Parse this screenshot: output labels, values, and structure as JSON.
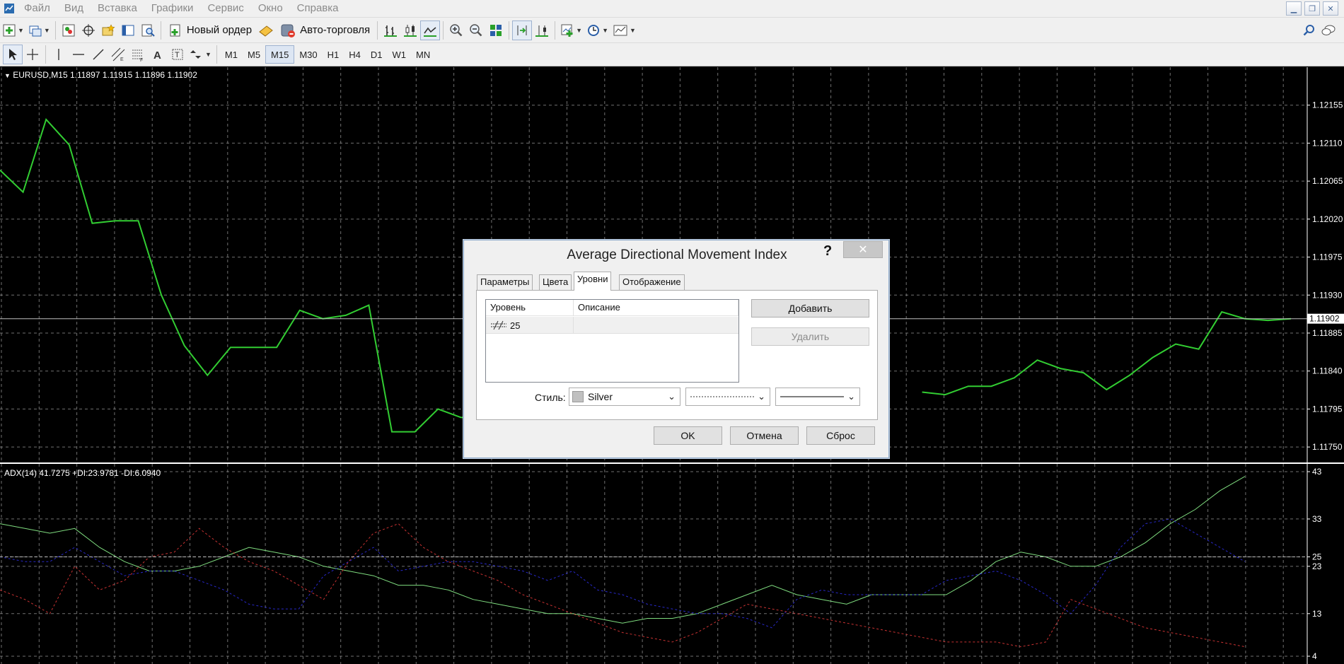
{
  "menu": [
    "Файл",
    "Вид",
    "Вставка",
    "Графики",
    "Сервис",
    "Окно",
    "Справка"
  ],
  "toolbar1": {
    "new_order_label": "Новый ордер",
    "autotrading_label": "Авто-торговля"
  },
  "timeframes": [
    "M1",
    "M5",
    "M15",
    "M30",
    "H1",
    "H4",
    "D1",
    "W1",
    "MN"
  ],
  "active_timeframe": "M15",
  "main_chart": {
    "caption": "EURUSD,M15  1.11897 1.11915 1.11896 1.11902",
    "price_labels": [
      "1.12155",
      "1.12110",
      "1.12065",
      "1.12020",
      "1.11975",
      "1.11930",
      "1.11885",
      "1.11840",
      "1.11795",
      "1.11750"
    ],
    "current_price": "1.11902",
    "line_color": "#32cd32"
  },
  "sub_chart": {
    "caption": "ADX(14) 41.7275 +DI:23.9781 -DI:6.0940",
    "scale_labels": [
      "43",
      "33",
      "25",
      "23",
      "13",
      "4"
    ]
  },
  "dialog": {
    "title": "Average Directional Movement Index",
    "help": "?",
    "close": "✕",
    "tabs": [
      "Параметры",
      "Цвета",
      "Уровни",
      "Отображение"
    ],
    "active_tab": "Уровни",
    "table": {
      "col_level": "Уровень",
      "col_description": "Описание",
      "rows": [
        {
          "level": "25",
          "description": ""
        }
      ]
    },
    "add_button": "Добавить",
    "delete_button": "Удалить",
    "style_label": "Стиль:",
    "color_value": "Silver",
    "color_swatch": "#c0c0c0",
    "ok_button": "OK",
    "cancel_button": "Отмена",
    "reset_button": "Сброс"
  },
  "chart_data": [
    {
      "type": "line",
      "title": "",
      "symbol": "EURUSD",
      "timeframe": "M15",
      "ylim": [
        1.1173,
        1.122
      ],
      "series": [
        {
          "color": "#32cd32",
          "values": [
            1.12078,
            1.12052,
            1.12138,
            1.12108,
            1.12015,
            1.12018,
            1.12018,
            1.1193,
            1.1187,
            1.11835,
            1.11868,
            1.11868,
            1.11868,
            1.11912,
            1.11902,
            1.11906,
            1.11918,
            1.11768,
            1.11768,
            1.11795,
            1.11785,
            1.11785,
            null,
            null,
            null,
            null,
            null,
            null,
            null,
            null,
            null,
            null,
            null,
            null,
            null,
            null,
            null,
            null,
            null,
            null,
            1.11815,
            1.11812,
            1.11822,
            1.11822,
            1.11832,
            1.11853,
            1.11843,
            1.11838,
            1.11818,
            1.11835,
            1.11856,
            1.11872,
            1.11866,
            1.1191,
            1.11902,
            1.119,
            1.11902
          ]
        }
      ],
      "grid": true
    },
    {
      "type": "line",
      "title": "",
      "indicator": "ADX(14)",
      "ylim": [
        4,
        43
      ],
      "levels": [
        25
      ],
      "series": [
        {
          "name": "ADX",
          "color": "#7fdc7f",
          "style": "solid",
          "values": [
            32,
            31,
            30,
            31,
            27,
            24,
            22,
            22,
            23,
            25,
            27,
            26,
            25,
            23,
            22,
            21,
            19,
            19,
            18,
            16,
            15,
            14,
            13,
            13,
            12,
            11,
            12,
            12,
            13,
            15,
            17,
            19,
            17,
            16,
            15,
            17,
            17,
            17,
            17,
            20,
            24,
            26,
            25,
            23,
            23,
            25,
            28,
            32,
            35,
            39,
            42
          ]
        },
        {
          "name": "+DI",
          "color": "#2828c8",
          "style": "dotted",
          "values": [
            25,
            24,
            24,
            27,
            24,
            21,
            22,
            22,
            20,
            18,
            15,
            14,
            14,
            21,
            24,
            27,
            22,
            23,
            24,
            24,
            23,
            22,
            20,
            22,
            18,
            17,
            15,
            14,
            13,
            13,
            12,
            10,
            16,
            18,
            17,
            17,
            17,
            17,
            20,
            21,
            22,
            20,
            17,
            13,
            19,
            27,
            32,
            33,
            30,
            27,
            24
          ]
        },
        {
          "name": "-DI",
          "color": "#c83232",
          "style": "dotted",
          "values": [
            18,
            16,
            13,
            23,
            18,
            20,
            25,
            26,
            31,
            27,
            24,
            22,
            19,
            16,
            24,
            30,
            32,
            27,
            24,
            22,
            20,
            17,
            15,
            13,
            11,
            9,
            8,
            7,
            9,
            12,
            15,
            14,
            13,
            12,
            11,
            10,
            9,
            8,
            7,
            7,
            7,
            6,
            7,
            16,
            14,
            12,
            10,
            9,
            8,
            7,
            6
          ]
        }
      ],
      "grid": true
    }
  ]
}
